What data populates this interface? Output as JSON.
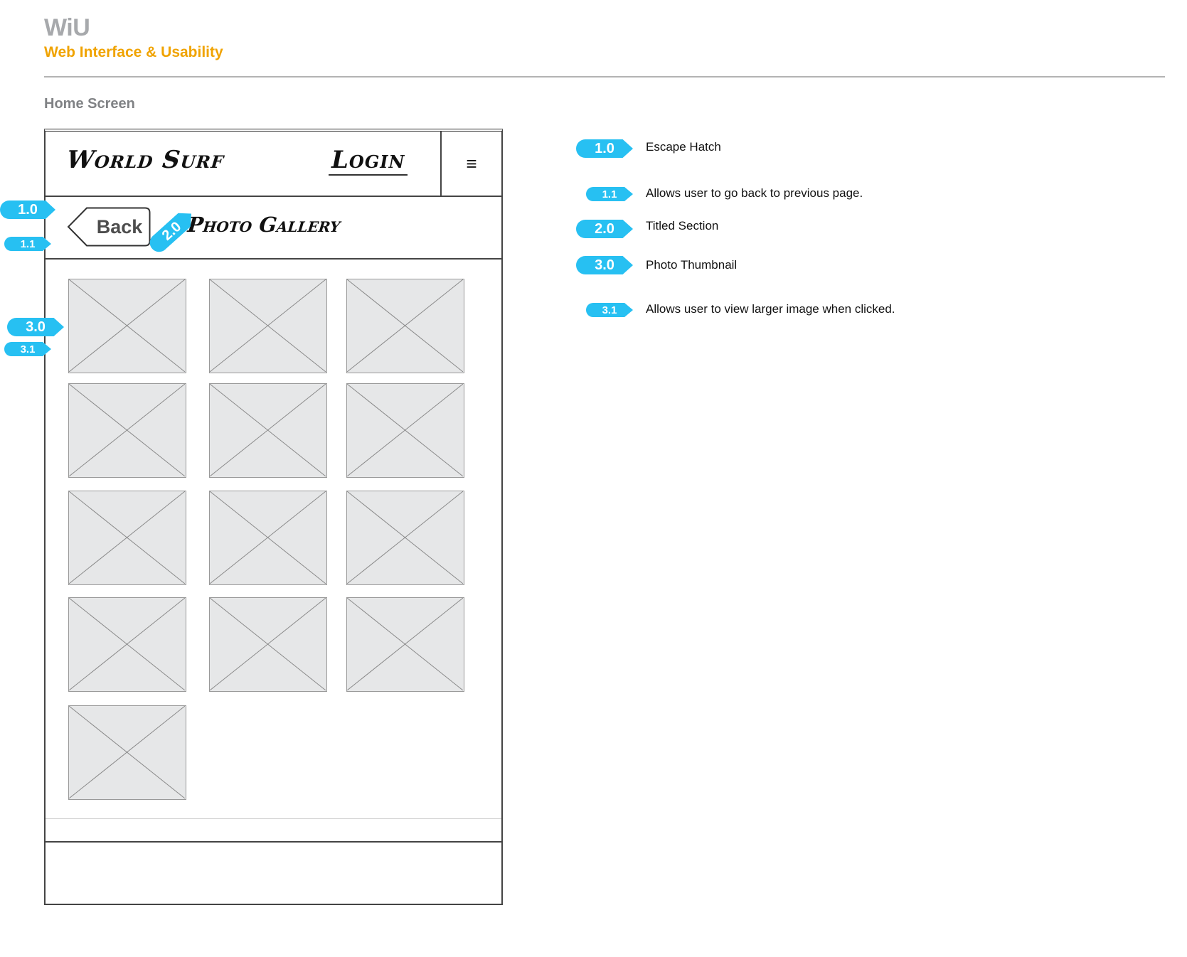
{
  "header": {
    "brand": "WiU",
    "subtitle": "Web Interface & Usability",
    "screen_title": "Home Screen"
  },
  "phone": {
    "logo": "World Surf",
    "login": "Login",
    "menu_glyph": "≡",
    "back_label": "Back",
    "gallery_title": "Photo Gallery",
    "thumbnail_count": 13
  },
  "callouts": {
    "c10": "1.0",
    "c11": "1.1",
    "c20": "2.0",
    "c30": "3.0",
    "c31": "3.1"
  },
  "legend": [
    {
      "id": "1.0",
      "text": "Escape Hatch"
    },
    {
      "id": "1.1",
      "text": "Allows user to go back to previous page."
    },
    {
      "id": "2.0",
      "text": "Titled Section"
    },
    {
      "id": "3.0",
      "text": "Photo Thumbnail"
    },
    {
      "id": "3.1",
      "text": "Allows user to view larger image when clicked."
    }
  ],
  "colors": {
    "accent": "#27c0f2",
    "brand_gray": "#a7a9ac",
    "brand_orange": "#f0a300"
  },
  "icons": {
    "menu": "hamburger-menu-icon",
    "thumbnail": "image-placeholder-icon",
    "back": "back-arrow-shape"
  }
}
